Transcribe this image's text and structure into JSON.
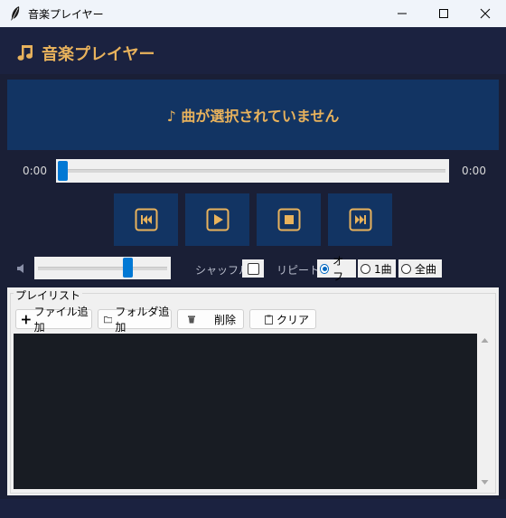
{
  "window": {
    "title": "音楽プレイヤー"
  },
  "header": {
    "title": "音楽プレイヤー"
  },
  "now_playing": {
    "text": "♪ 曲が選択されていません"
  },
  "seek": {
    "current_time": "0:00",
    "total_time": "0:00",
    "position": 0.0
  },
  "controls": {
    "prev_icon": "skip-previous-icon",
    "play_icon": "play-icon",
    "stop_icon": "stop-icon",
    "next_icon": "skip-next-icon"
  },
  "volume": {
    "icon": "speaker-icon",
    "level": 0.7
  },
  "shuffle": {
    "label": "シャッフル:",
    "checked": false
  },
  "repeat": {
    "label": "リピート:",
    "options": [
      "オフ",
      "1曲",
      "全曲"
    ],
    "selected": "オフ"
  },
  "playlist": {
    "legend": "プレイリスト",
    "buttons": {
      "add_file": "ファイル追加",
      "add_folder": "フォルダ追加",
      "delete": "削除",
      "clear": "クリア"
    },
    "items": []
  },
  "colors": {
    "accent": "#e8b25c",
    "panel": "#123463",
    "background": "#1a1f36",
    "selection": "#0078d4"
  }
}
